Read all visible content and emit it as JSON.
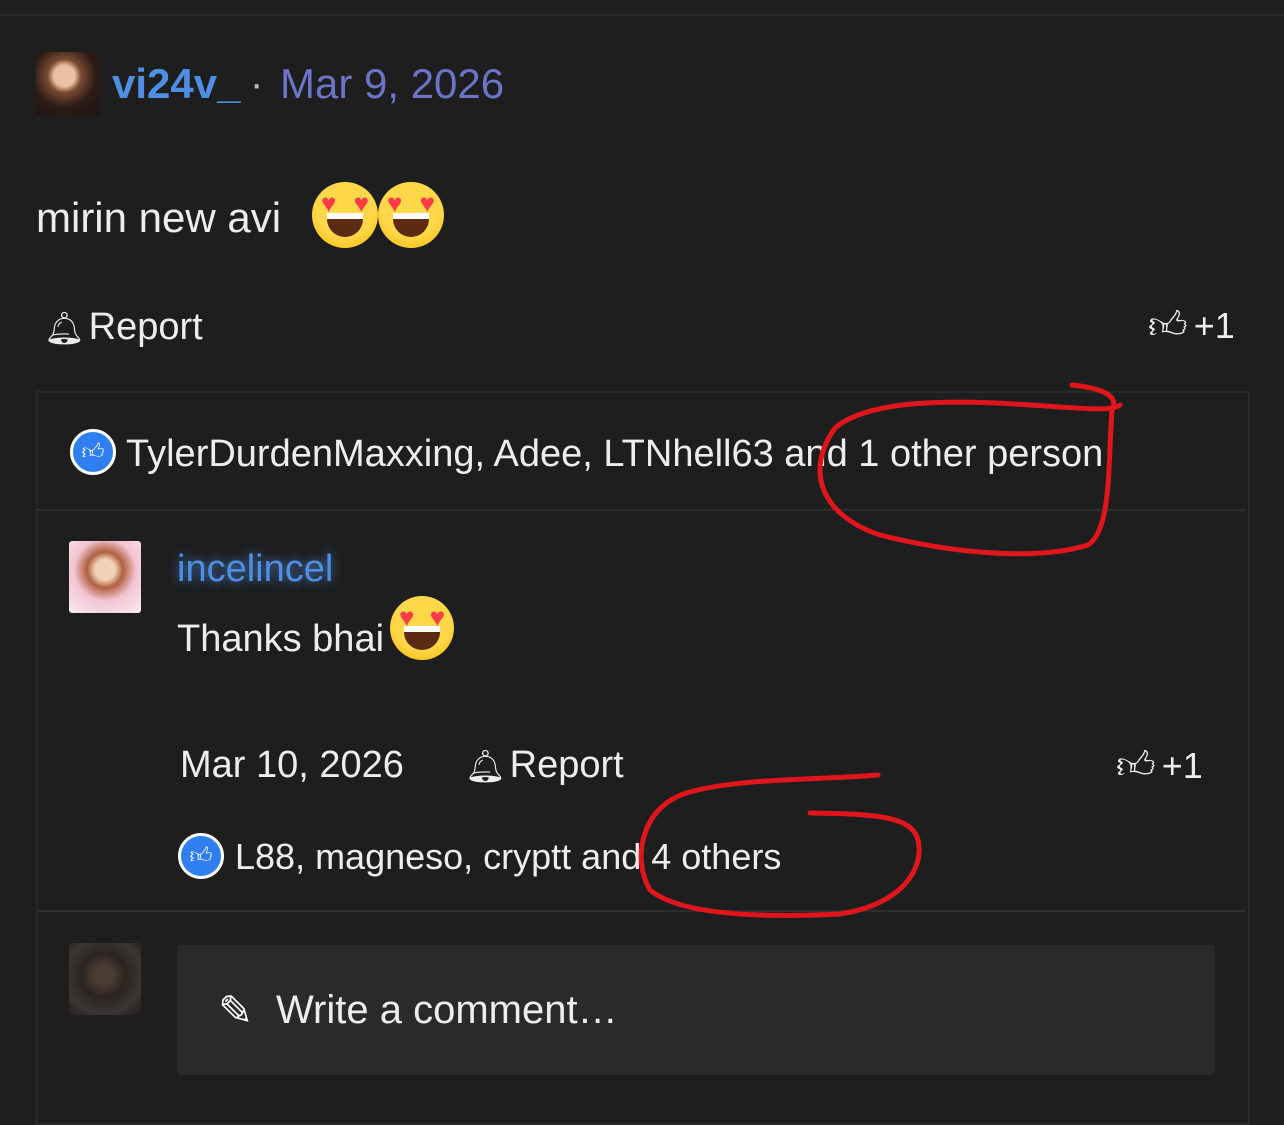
{
  "post": {
    "username": "vi24v_",
    "separator": "·",
    "date": "Mar 9, 2026",
    "text": "mirin new avi",
    "emojis": [
      "smiling-face-with-heart-eyes",
      "smiling-face-with-heart-eyes"
    ],
    "report_label": "Report",
    "reaction_count": "+1",
    "likers": "TylerDurdenMaxxing, Adee, LTNhell63 and 1 other person"
  },
  "reply": {
    "username": "incelincel",
    "text": "Thanks bhai",
    "emoji": "smiling-face-with-heart-eyes",
    "date": "Mar 10, 2026",
    "report_label": "Report",
    "reaction_count": "+1",
    "likers": "L88, magneso, cryptt and 4 others"
  },
  "composer": {
    "placeholder": "Write a comment…"
  },
  "icons": {
    "bell": "bell-icon",
    "thumb": "thumbs-up-icon",
    "like_badge": "like-badge-icon",
    "pencil": "pencil-icon"
  },
  "colors": {
    "background": "#1e1e1f",
    "username": "#4f8fe3",
    "date": "#6b74c6",
    "like_badge": "#2f7ff0",
    "annotation": "#e0161c"
  }
}
